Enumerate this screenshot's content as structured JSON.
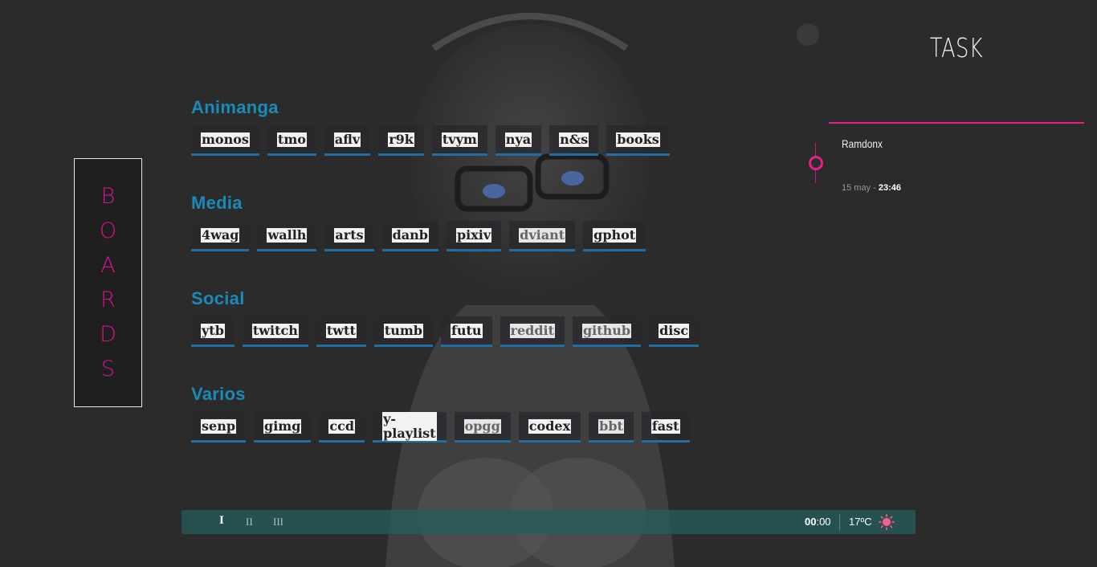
{
  "boards": {
    "letters": [
      "B",
      "O",
      "A",
      "R",
      "D",
      "S"
    ]
  },
  "categories": [
    {
      "title": "Animanga",
      "links": [
        {
          "label": "monos",
          "dim": false
        },
        {
          "label": "tmo",
          "dim": false
        },
        {
          "label": "aflv",
          "dim": false
        },
        {
          "label": "r9k",
          "dim": false
        },
        {
          "label": "tvym",
          "dim": false
        },
        {
          "label": "nya",
          "dim": false
        },
        {
          "label": "n&s",
          "dim": false
        },
        {
          "label": "books",
          "dim": false
        }
      ]
    },
    {
      "title": "Media",
      "links": [
        {
          "label": "4wag",
          "dim": false
        },
        {
          "label": "wallh",
          "dim": false
        },
        {
          "label": "arts",
          "dim": false
        },
        {
          "label": "danb",
          "dim": false
        },
        {
          "label": "pixiv",
          "dim": false
        },
        {
          "label": "dviant",
          "dim": true
        },
        {
          "label": "gphot",
          "dim": false
        }
      ]
    },
    {
      "title": "Social",
      "links": [
        {
          "label": "ytb",
          "dim": false
        },
        {
          "label": "twitch",
          "dim": false
        },
        {
          "label": "twtt",
          "dim": false
        },
        {
          "label": "tumb",
          "dim": false
        },
        {
          "label": "futu",
          "dim": false
        },
        {
          "label": "reddit",
          "dim": true
        },
        {
          "label": "github",
          "dim": true
        },
        {
          "label": "disc",
          "dim": false
        }
      ]
    },
    {
      "title": "Varios",
      "links": [
        {
          "label": "senp",
          "dim": false
        },
        {
          "label": "gimg",
          "dim": false
        },
        {
          "label": "ccd",
          "dim": false
        },
        {
          "label": "y-playlist",
          "dim": false
        },
        {
          "label": "opgg",
          "dim": true
        },
        {
          "label": "codex",
          "dim": false
        },
        {
          "label": "bbt",
          "dim": true
        },
        {
          "label": "fast",
          "dim": false
        }
      ]
    }
  ],
  "task": {
    "title": "TASK",
    "items": [
      {
        "name": "Ramdonx",
        "date": "15 may - ",
        "time": "23:46"
      }
    ]
  },
  "bottom_bar": {
    "tabs": [
      "I",
      "II",
      "III"
    ],
    "active_tab": 0,
    "clock_hours": "00",
    "clock_minutes": ":00",
    "temperature": "17ºC",
    "weather_icon": "sun-icon"
  },
  "colors": {
    "accent_pink": "#e91e8c",
    "accent_blue": "#1a8ab8",
    "bar_teal": "#275c5c"
  }
}
